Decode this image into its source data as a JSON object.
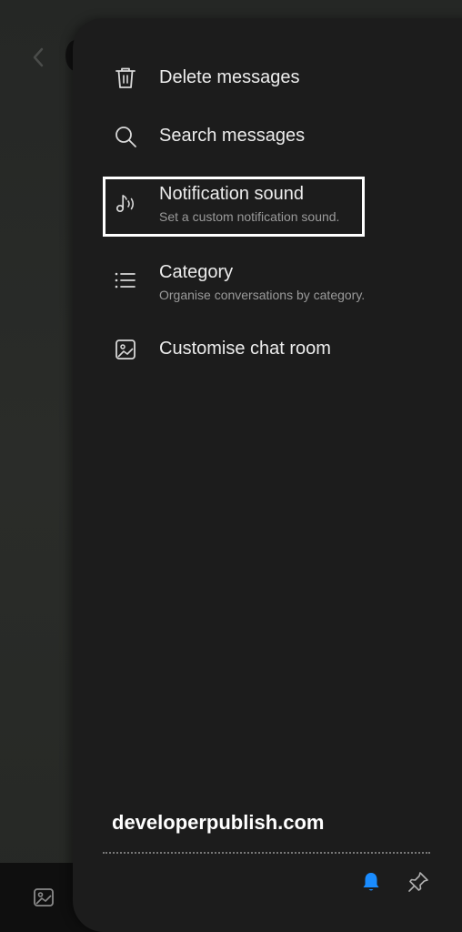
{
  "menu": {
    "items": [
      {
        "title": "Delete messages",
        "icon": "trash-icon"
      },
      {
        "title": "Search messages",
        "icon": "search-icon"
      },
      {
        "title": "Notification sound",
        "subtitle": "Set a custom notification sound.",
        "icon": "music-note-icon",
        "highlighted": true
      },
      {
        "title": "Category",
        "subtitle": "Organise conversations by category.",
        "icon": "list-icon"
      },
      {
        "title": "Customise chat room",
        "icon": "image-frame-icon"
      }
    ]
  },
  "watermark": "developerpublish.com",
  "colors": {
    "panel_bg": "#1c1c1c",
    "accent_blue": "#1a8cff",
    "text_primary": "#ececec",
    "text_secondary": "#9a9a9a"
  },
  "bottom_icons": [
    "bell-icon",
    "pin-icon"
  ]
}
